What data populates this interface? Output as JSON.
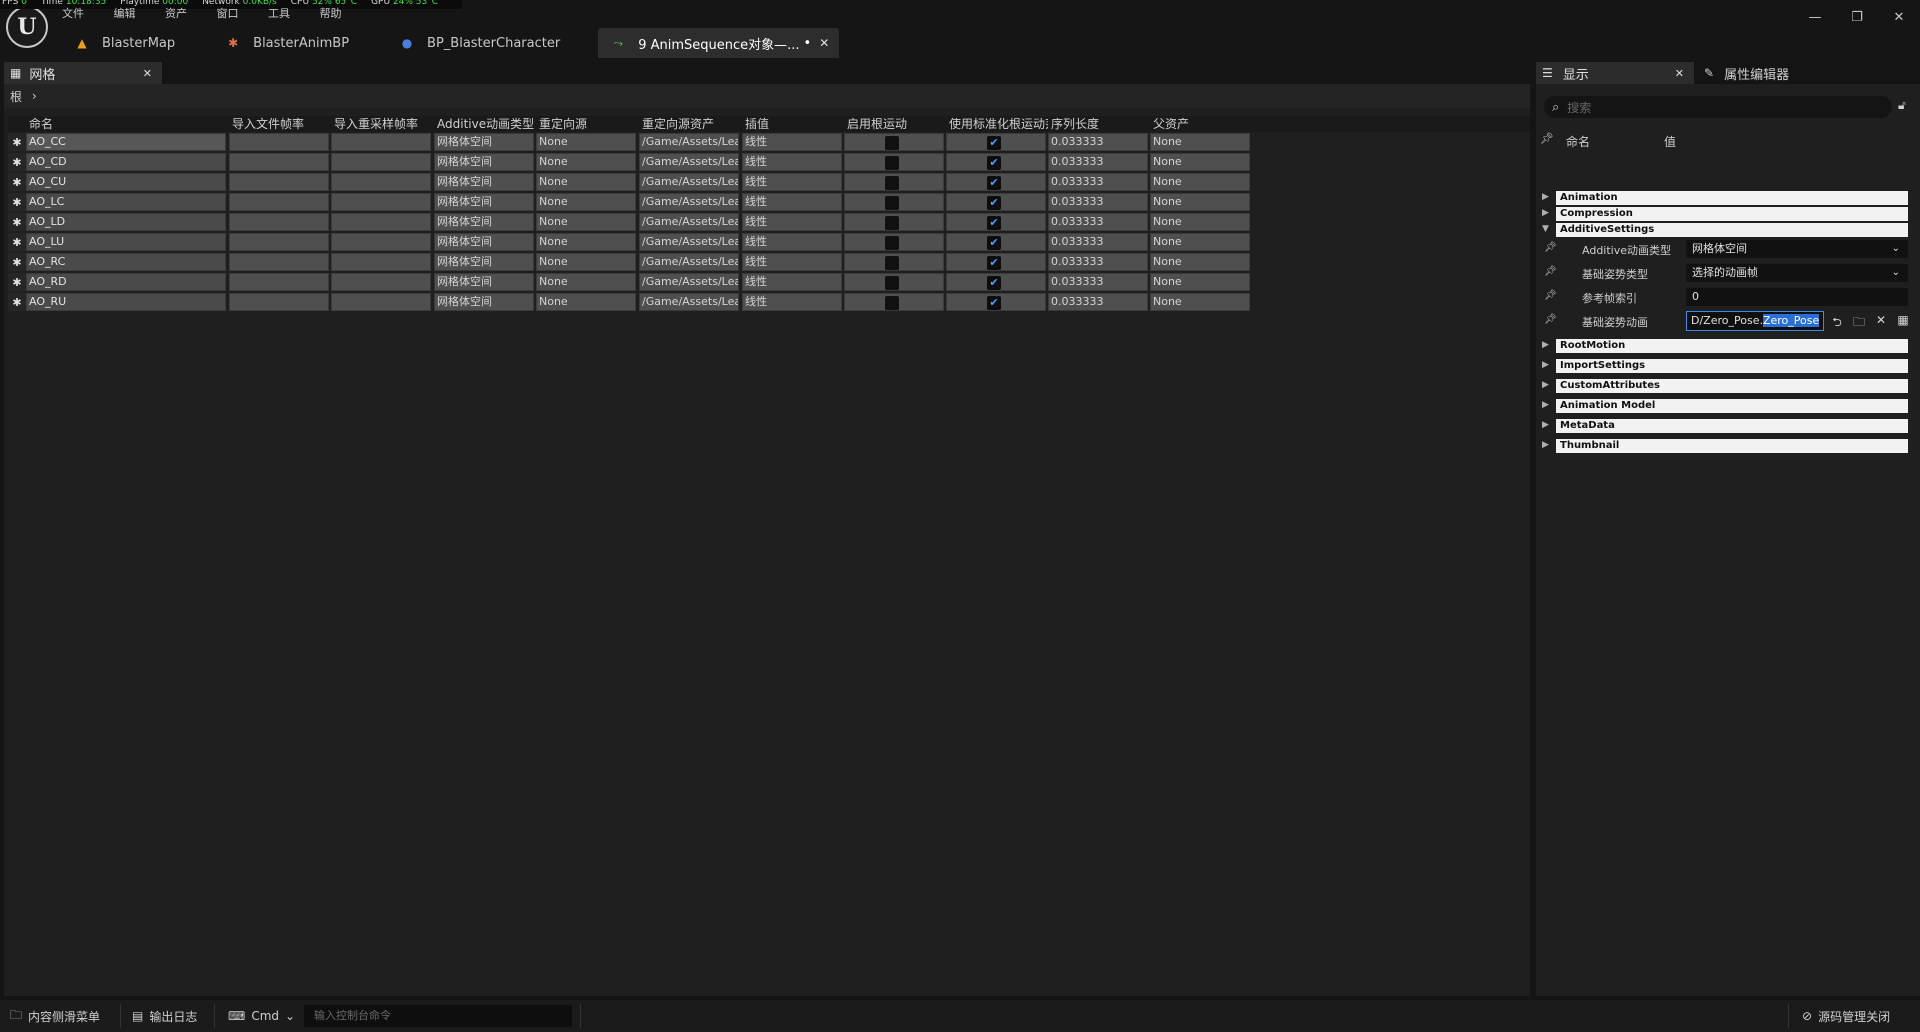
{
  "stats": [
    {
      "k": "FPS",
      "v": "0"
    },
    {
      "k": "Time",
      "v": "10:18:35"
    },
    {
      "k": "Playtime",
      "v": "00:00"
    },
    {
      "k": "Network",
      "v": "0.0KB/s"
    },
    {
      "k": "CPU",
      "v": "52% 65°C"
    },
    {
      "k": "GPU",
      "v": "24% 53°C"
    }
  ],
  "menu": [
    "文件",
    "编辑",
    "资产",
    "窗口",
    "工具",
    "帮助"
  ],
  "window_controls": {
    "minimize": "—",
    "restore": "❐",
    "close": "✕"
  },
  "doc_tabs": [
    {
      "label": "BlasterMap",
      "icon": "level-icon",
      "color": "#e8a020"
    },
    {
      "label": "BlasterAnimBP",
      "icon": "anim-blueprint-icon",
      "color": "#e07040"
    },
    {
      "label": "BP_BlasterCharacter",
      "icon": "character-icon",
      "color": "#4a7fe0"
    },
    {
      "label": "9 AnimSequence对象—...",
      "icon": "anim-sequence-icon",
      "color": "#60c060",
      "modified": "•",
      "active": true
    }
  ],
  "left_panel": {
    "tab_label": "网格",
    "breadcrumb_root": "根"
  },
  "grid": {
    "columns": [
      "命名",
      "导入文件帧率",
      "导入重采样帧率",
      "Additive动画类型",
      "重定向源",
      "重定向源资产",
      "插值",
      "启用根运动",
      "使用标准化根运动范围",
      "序列长度",
      "父资产"
    ],
    "rows": [
      {
        "name": "AO_CC",
        "additive": "网格体空间",
        "retarget": "None",
        "asset": "/Game/Assets/Lea",
        "interp": "线性",
        "root_motion": false,
        "normalized": true,
        "length": "0.033333",
        "parent": "None"
      },
      {
        "name": "AO_CD",
        "additive": "网格体空间",
        "retarget": "None",
        "asset": "/Game/Assets/Lea",
        "interp": "线性",
        "root_motion": false,
        "normalized": true,
        "length": "0.033333",
        "parent": "None"
      },
      {
        "name": "AO_CU",
        "additive": "网格体空间",
        "retarget": "None",
        "asset": "/Game/Assets/Lea",
        "interp": "线性",
        "root_motion": false,
        "normalized": true,
        "length": "0.033333",
        "parent": "None"
      },
      {
        "name": "AO_LC",
        "additive": "网格体空间",
        "retarget": "None",
        "asset": "/Game/Assets/Lea",
        "interp": "线性",
        "root_motion": false,
        "normalized": true,
        "length": "0.033333",
        "parent": "None"
      },
      {
        "name": "AO_LD",
        "additive": "网格体空间",
        "retarget": "None",
        "asset": "/Game/Assets/Lea",
        "interp": "线性",
        "root_motion": false,
        "normalized": true,
        "length": "0.033333",
        "parent": "None"
      },
      {
        "name": "AO_LU",
        "additive": "网格体空间",
        "retarget": "None",
        "asset": "/Game/Assets/Lea",
        "interp": "线性",
        "root_motion": false,
        "normalized": true,
        "length": "0.033333",
        "parent": "None"
      },
      {
        "name": "AO_RC",
        "additive": "网格体空间",
        "retarget": "None",
        "asset": "/Game/Assets/Lea",
        "interp": "线性",
        "root_motion": false,
        "normalized": true,
        "length": "0.033333",
        "parent": "None"
      },
      {
        "name": "AO_RD",
        "additive": "网格体空间",
        "retarget": "None",
        "asset": "/Game/Assets/Lea",
        "interp": "线性",
        "root_motion": false,
        "normalized": true,
        "length": "0.033333",
        "parent": "None"
      },
      {
        "name": "AO_RU",
        "additive": "网格体空间",
        "retarget": "None",
        "asset": "/Game/Assets/Lea",
        "interp": "线性",
        "root_motion": false,
        "normalized": true,
        "length": "0.033333",
        "parent": "None"
      }
    ]
  },
  "right_panel": {
    "tab_display": "显示",
    "tab_property_editor": "属性编辑器",
    "search_placeholder": "搜索",
    "header_name": "命名",
    "header_value": "值",
    "categories_top": [
      "Animation",
      "Compression",
      "AdditiveSettings"
    ],
    "additive_props": {
      "additive_type_label": "Additive动画类型",
      "additive_type_value": "网格体空间",
      "base_pose_type_label": "基础姿势类型",
      "base_pose_type_value": "选择的动画帧",
      "ref_frame_label": "参考帧索引",
      "ref_frame_value": "0",
      "base_pose_anim_label": "基础姿势动画",
      "base_pose_anim_prefix": "D/Zero_Pose.",
      "base_pose_anim_selected": "Zero_Pose"
    },
    "categories_bottom": [
      "RootMotion",
      "ImportSettings",
      "CustomAttributes",
      "Animation Model",
      "MetaData",
      "Thumbnail"
    ]
  },
  "status_bar": {
    "content_drawer": "内容侧滑菜单",
    "output_log": "输出日志",
    "cmd": "Cmd",
    "console_placeholder": "输入控制台命令",
    "source_control": "源码管理关闭"
  }
}
